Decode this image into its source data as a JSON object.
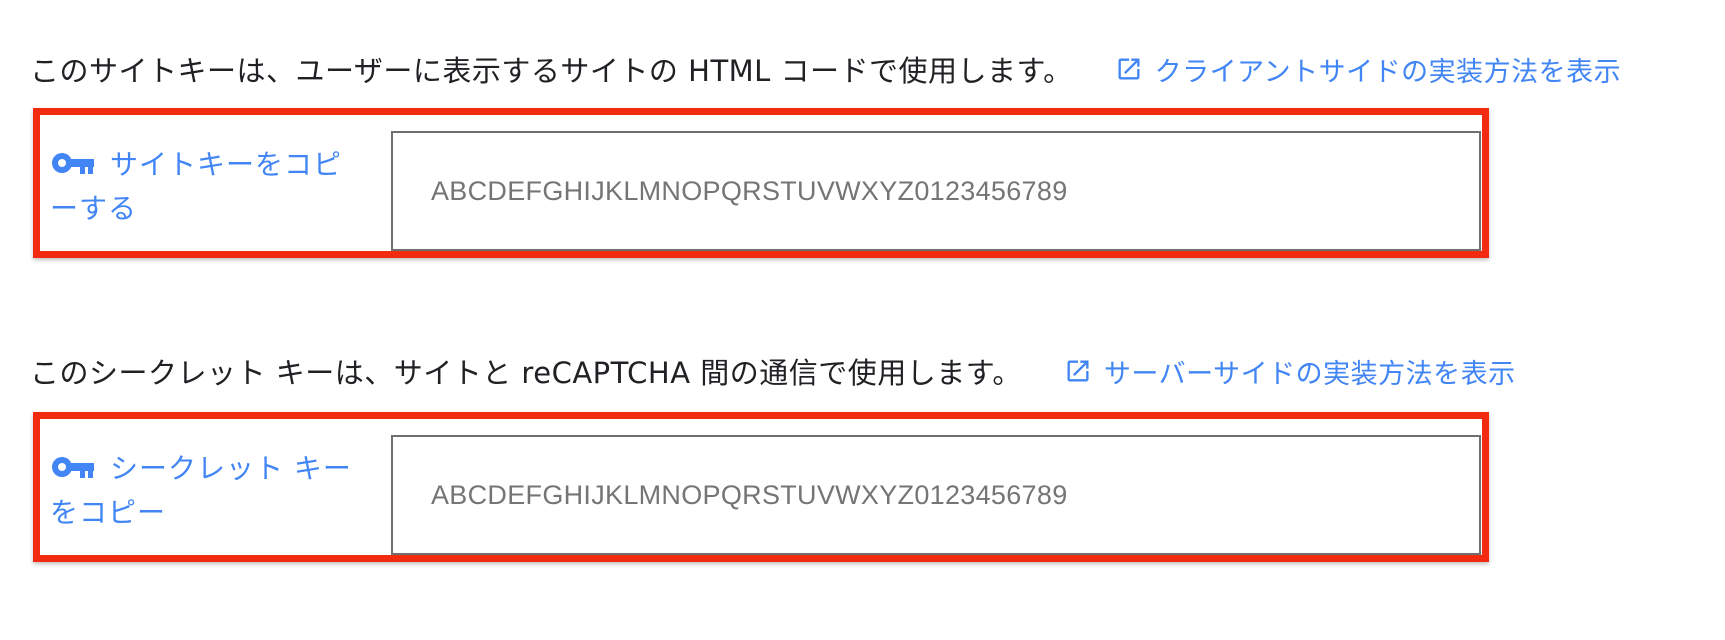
{
  "site_key": {
    "description": "このサイトキーは、ユーザーに表示するサイトの HTML コードで使用します。",
    "link_label": "クライアントサイドの実装方法を表示",
    "copy_label": "サイトキーをコピーする",
    "value": "ABCDEFGHIJKLMNOPQRSTUVWXYZ0123456789"
  },
  "secret_key": {
    "description": "このシークレット キーは、サイトと reCAPTCHA 間の通信で使用します。",
    "link_label": "サーバーサイドの実装方法を表示",
    "copy_label": "シークレット キーをコピー",
    "value": "ABCDEFGHIJKLMNOPQRSTUVWXYZ0123456789"
  },
  "colors": {
    "link": "#4285f4",
    "highlight_border": "#f22b10",
    "text": "#202124",
    "field_text": "#757575"
  },
  "icons": {
    "copy": "key-icon",
    "external_link": "open-in-new-icon"
  }
}
